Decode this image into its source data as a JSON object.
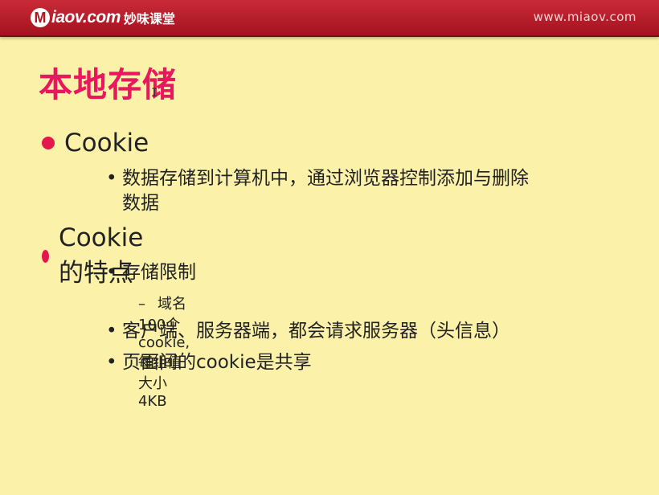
{
  "header": {
    "logo_letter": "M",
    "logo_text": "iaov.com",
    "logo_cn": "妙味课堂",
    "site_url": "www.miaov.com"
  },
  "slide": {
    "title": "本地存储",
    "sections": [
      {
        "heading": "Cookie",
        "items": [
          {
            "text_line1": "数据存储到计算机中，通过浏览器控制添加与删除",
            "text_line2": "数据"
          }
        ]
      },
      {
        "heading": "Cookie的特点",
        "items": [
          {
            "text": "存储限制",
            "sub": "域名100个cookie,每组值大小4KB"
          },
          {
            "text": "客户端、服务器端，都会请求服务器（头信息）"
          },
          {
            "text": "页面间的cookie是共享"
          }
        ]
      }
    ]
  },
  "cursor": "I",
  "colors": {
    "background": "#fbf1a9",
    "header": "#b8192a",
    "title": "#e8185e",
    "bullet": "#e4174c"
  }
}
